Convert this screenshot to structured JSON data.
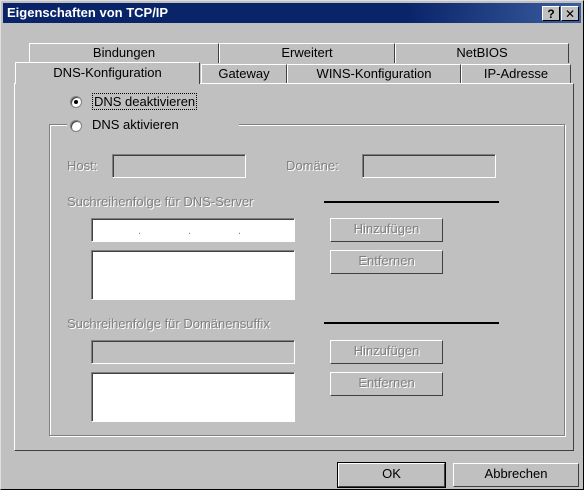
{
  "window": {
    "title": "Eigenschaften von TCP/IP",
    "help_glyph": "?",
    "close_glyph": "✕"
  },
  "tabs_back": [
    "Bindungen",
    "Erweitert",
    "NetBIOS"
  ],
  "tabs_front": [
    "DNS-Konfiguration",
    "Gateway",
    "WINS-Konfiguration",
    "IP-Adresse"
  ],
  "dns": {
    "disable_label": "DNS deaktivieren",
    "enable_label": "DNS aktivieren",
    "host_label": "Host:",
    "domain_label": "Domäne:",
    "server_order_label": "Suchreihenfolge für DNS-Server",
    "suffix_order_label": "Suchreihenfolge für Domänensuffix",
    "ip_separator": "."
  },
  "buttons": {
    "add": "Hinzufügen",
    "remove": "Entfernen",
    "ok": "OK",
    "cancel": "Abbrechen"
  }
}
